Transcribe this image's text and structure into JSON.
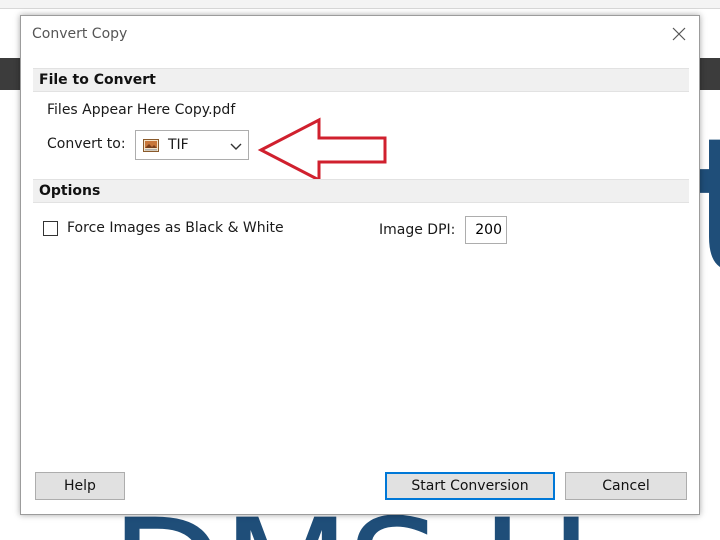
{
  "dialog": {
    "title": "Convert Copy",
    "close_icon": "close-icon"
  },
  "file_section": {
    "header": "File to Convert",
    "file_name": "Files Appear Here Copy.pdf",
    "convert_label": "Convert to:",
    "format_value": "TIF",
    "format_icon": "image-file-icon"
  },
  "options_section": {
    "header": "Options",
    "force_bw_label": "Force Images as Black & White",
    "force_bw_checked": false,
    "dpi_label": "Image DPI:",
    "dpi_value": "200"
  },
  "buttons": {
    "help": "Help",
    "start": "Start Conversion",
    "cancel": "Cancel"
  },
  "colors": {
    "annotation_arrow": "#d0202e",
    "default_button_border": "#0078d7",
    "background_text": "#1f4e79"
  }
}
